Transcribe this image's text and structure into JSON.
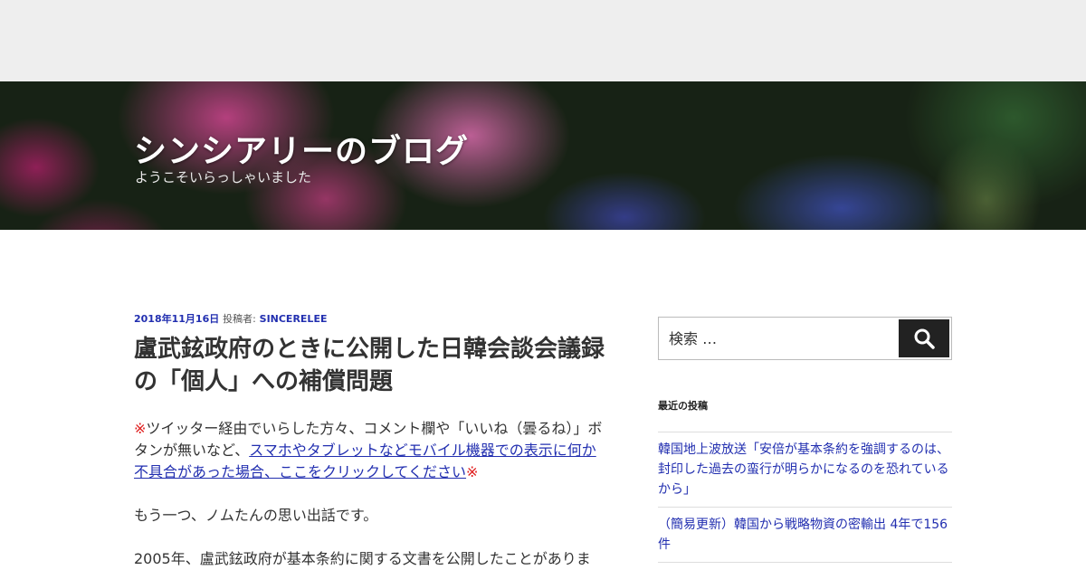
{
  "site": {
    "title": "シンシアリーのブログ",
    "description": "ようこそいらっしゃいました"
  },
  "post": {
    "date": "2018年11月16日",
    "by_label": "投稿者:",
    "author": "SINCERELEE",
    "title": "盧武鉉政府のときに公開した日韓会談会議録の「個人」への補償問題",
    "p1_mark_start": "※",
    "p1_text": "ツイッター経由でいらした方々、コメント欄や「いいね（曇るね）」ボタンが無いなど、",
    "p1_link": "スマホやタブレットなどモバイル機器での表示に何か不具合があった場合、ここをクリックしてください",
    "p1_mark_end": "※",
    "p2": "もう一つ、ノムたんの思い出話です。",
    "p3": "2005年、盧武鉉政府が基本条約に関する文書を公開したことがありま"
  },
  "sidebar": {
    "search_placeholder": "検索 …",
    "search_icon": "magnifier-icon",
    "recent_title": "最近の投稿",
    "recent_posts": [
      "韓国地上波放送「安倍が基本条約を強調するのは、封印した過去の蛮行が明らかになるのを恐れているから」",
      "（簡易更新）韓国から戦略物資の密輸出 4年で156件"
    ]
  },
  "colors": {
    "link": "#222fb0",
    "mark": "#e02020",
    "topbar": "#eeeeee",
    "search_button": "#222222"
  }
}
